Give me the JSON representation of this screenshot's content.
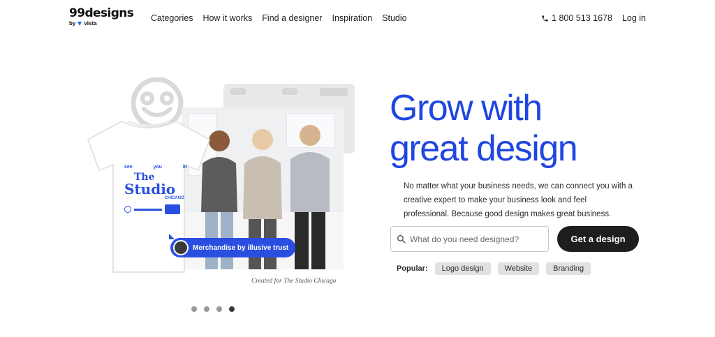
{
  "header": {
    "logo_text": "99designs",
    "logo_by": "by",
    "logo_vista": "vista",
    "nav": [
      {
        "label": "Categories"
      },
      {
        "label": "How it works"
      },
      {
        "label": "Find a designer"
      },
      {
        "label": "Inspiration"
      },
      {
        "label": "Studio"
      }
    ],
    "phone": "1 800 513 1678",
    "login": "Log in"
  },
  "hero": {
    "headline_line1": "Grow with",
    "headline_line2": "great design",
    "subtext": "No matter what your business needs, we can connect you with a creative expert to make your business look and feel professional. Because good design makes great business.",
    "search_placeholder": "What do you need designed?",
    "cta_label": "Get a design",
    "popular_label": "Popular:",
    "popular_tags": [
      "Logo design",
      "Website",
      "Branding"
    ],
    "chip_label": "Merchandise by illusive trust",
    "caption": "Created for The Studio Chicago",
    "tshirt_text": {
      "see": "see",
      "you": "you",
      "in": "in",
      "the": "The",
      "studio": "Studio",
      "city": "CHICAGO"
    },
    "carousel": {
      "count": 4,
      "active_index": 3
    }
  },
  "colors": {
    "brand_blue": "#1f46e0",
    "chip_blue": "#2a4fe0",
    "cta_black": "#1e1e1e",
    "tag_grey": "#e1e1e1"
  },
  "icons": {
    "phone": "phone-icon",
    "search": "search-icon",
    "smiley": "smiley-icon"
  }
}
